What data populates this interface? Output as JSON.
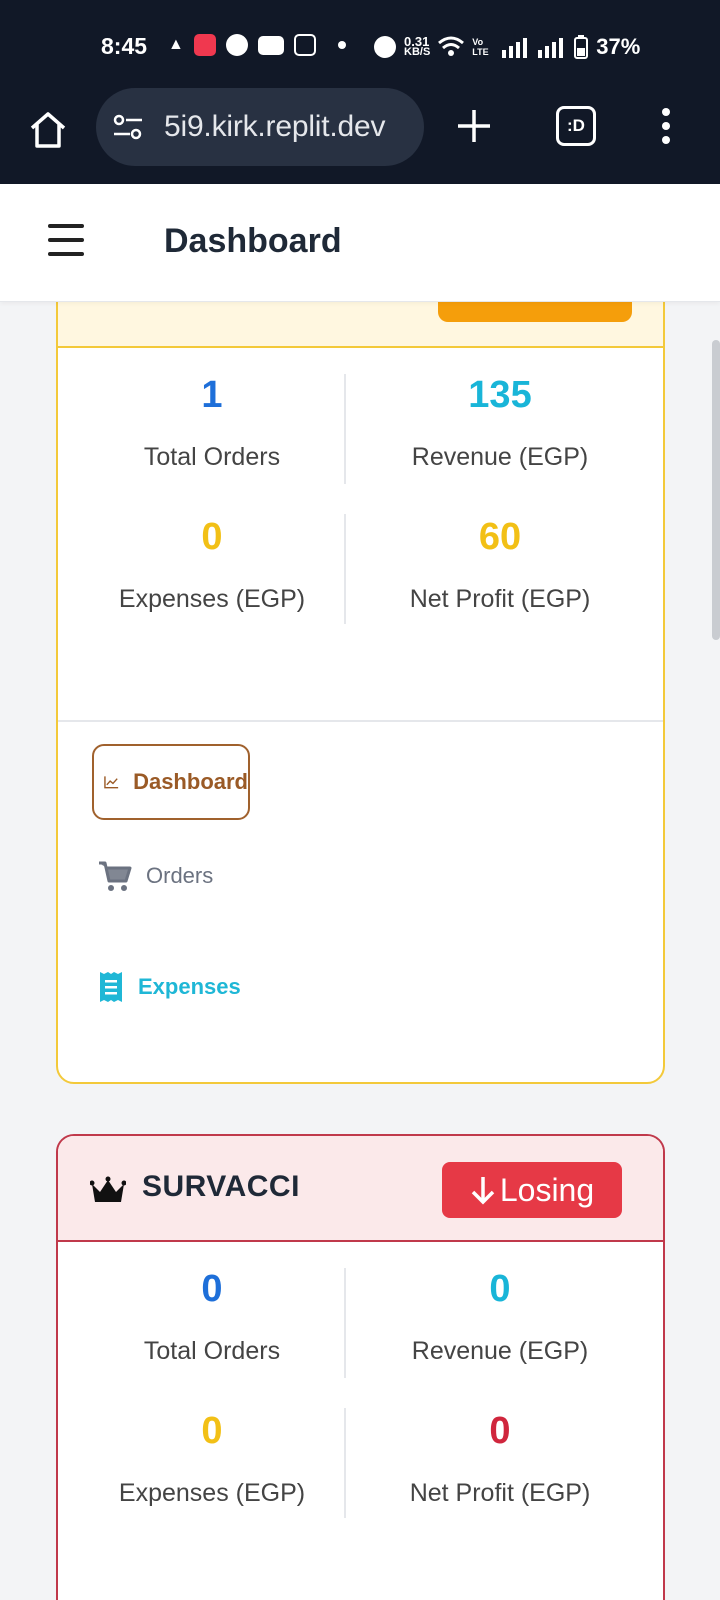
{
  "status_bar": {
    "time": "8:45",
    "network_speed": "0.31",
    "network_unit": "KB/S",
    "carrier": "Vo LTE",
    "battery": "37%"
  },
  "browser": {
    "url": "5i9.kirk.replit.dev",
    "tab_label": ":D"
  },
  "header": {
    "title": "Dashboard"
  },
  "shops": [
    {
      "name": "",
      "status": "",
      "accent": "#f3c93a",
      "stats": {
        "total_orders": {
          "value": "1",
          "label": "Total Orders",
          "color": "#1e6fd9"
        },
        "revenue": {
          "value": "135",
          "label": "Revenue (EGP)",
          "color": "#19b5d8"
        },
        "expenses": {
          "value": "0",
          "label": "Expenses (EGP)",
          "color": "#f2c016"
        },
        "net_profit": {
          "value": "60",
          "label": "Net Profit (EGP)",
          "color": "#f2c016"
        }
      },
      "nav": {
        "dashboard": "Dashboard",
        "orders": "Orders",
        "expenses": "Expenses"
      }
    },
    {
      "name": "SURVACCI",
      "status": "Losing",
      "accent": "#c0394b",
      "stats": {
        "total_orders": {
          "value": "0",
          "label": "Total Orders",
          "color": "#1e6fd9"
        },
        "revenue": {
          "value": "0",
          "label": "Revenue (EGP)",
          "color": "#19b5d8"
        },
        "expenses": {
          "value": "0",
          "label": "Expenses (EGP)",
          "color": "#f2c016"
        },
        "net_profit": {
          "value": "0",
          "label": "Net Profit (EGP)",
          "color": "#d0263d"
        }
      }
    }
  ]
}
